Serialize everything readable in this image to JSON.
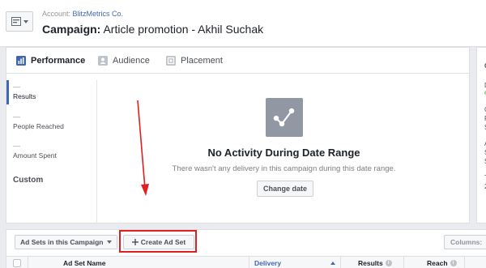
{
  "header": {
    "account_label": "Account:",
    "account_name": "BlitzMetrics Co.",
    "campaign_label": "Campaign:",
    "campaign_name": "Article promotion - Akhil Suchak"
  },
  "tabs": [
    {
      "label": "Performance",
      "icon": "bar-chart-icon",
      "active": true
    },
    {
      "label": "Audience",
      "icon": "people-icon",
      "active": false
    },
    {
      "label": "Placement",
      "icon": "placement-icon",
      "active": false
    }
  ],
  "metrics": [
    {
      "value": "—",
      "label": "Results",
      "active": true
    },
    {
      "value": "—",
      "label": "People Reached",
      "active": false
    },
    {
      "value": "—",
      "label": "Amount Spent",
      "active": false
    }
  ],
  "custom_label": "Custom",
  "empty_state": {
    "icon": "share-graph-icon",
    "title": "No Activity During Date Range",
    "description": "There wasn't any delivery in this campaign during this date range.",
    "button_label": "Change date"
  },
  "right_panel": {
    "items": [
      "C",
      "D",
      "e",
      "C",
      "F",
      "S",
      "A",
      "S",
      "S",
      "T",
      "2"
    ]
  },
  "toolbar": {
    "adsets_dropdown": "Ad Sets in this Campaign",
    "create_button": "Create Ad Set",
    "columns_button": "Columns:"
  },
  "table": {
    "columns": [
      {
        "label": "Ad Set Name",
        "sortable": false
      },
      {
        "label": "Delivery",
        "sortable": true,
        "sorted": "asc"
      },
      {
        "label": "Results",
        "info": true
      },
      {
        "label": "Reach",
        "info": true
      }
    ]
  },
  "colors": {
    "brand_blue": "#4267b2",
    "annotation_red": "#e02020",
    "page_bg": "#e9ebee"
  }
}
